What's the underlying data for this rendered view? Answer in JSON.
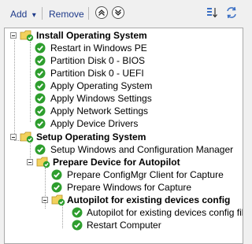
{
  "toolbar": {
    "add_label": "Add",
    "add_arrow": "▾",
    "remove_label": "Remove",
    "move_up_icon": "move-up-icon",
    "move_down_icon": "move-down-icon"
  },
  "tree": {
    "groups": [
      {
        "label": "Install Operating System",
        "items": [
          "Restart in Windows PE",
          "Partition Disk 0 - BIOS",
          "Partition Disk 0 - UEFI",
          "Apply Operating System",
          "Apply Windows Settings",
          "Apply Network Settings",
          "Apply Device Drivers"
        ]
      },
      {
        "label": "Setup Operating System",
        "items": [
          "Setup Windows and Configuration Manager"
        ],
        "subgroup": {
          "label": "Prepare Device for Autopilot",
          "items": [
            "Prepare ConfigMgr Client for Capture",
            "Prepare Windows for Capture"
          ],
          "subgroup": {
            "label": "Autopilot for existing devices config",
            "items": [
              "Autopilot for existing devices config file",
              "Restart Computer"
            ]
          }
        }
      }
    ]
  },
  "colors": {
    "link_blue": "#1e3a8a",
    "check_green": "#2e9e2e",
    "folder_yellow": "#f2d15c"
  }
}
